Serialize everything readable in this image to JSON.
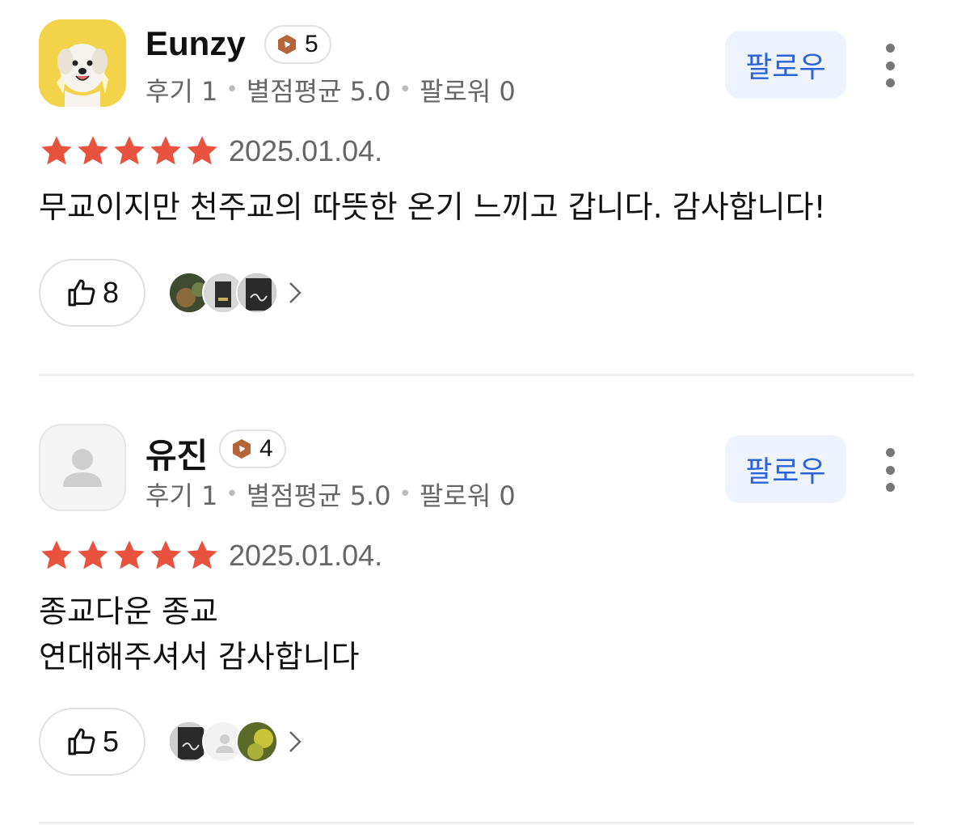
{
  "reviews": [
    {
      "username": "Eunzy",
      "level": "5",
      "stats": {
        "reviews": "후기 1",
        "avg_rating": "별점평균 5.0",
        "followers": "팔로워 0"
      },
      "follow_label": "팔로우",
      "rating": 5,
      "date": "2025.01.04.",
      "text": "무교이지만 천주교의 따뜻한 온기 느끼고 갑니다. 감사합니다!",
      "likes": "8"
    },
    {
      "username": "유진",
      "level": "4",
      "stats": {
        "reviews": "후기 1",
        "avg_rating": "별점평균 5.0",
        "followers": "팔로워 0"
      },
      "follow_label": "팔로우",
      "rating": 5,
      "date": "2025.01.04.",
      "text": "종교다운 종교\n연대해주셔서 감사합니다",
      "likes": "5"
    }
  ],
  "colors": {
    "star": "#e8523f",
    "follow_text": "#2a64d8",
    "follow_bg": "#eef3ff",
    "badge": "#b5653a",
    "stats_text": "#666666"
  },
  "icons": [
    "level-badge-icon",
    "star-icon",
    "thumbs-up-icon",
    "more-vertical-icon",
    "chevron-right-icon",
    "default-user-icon"
  ]
}
